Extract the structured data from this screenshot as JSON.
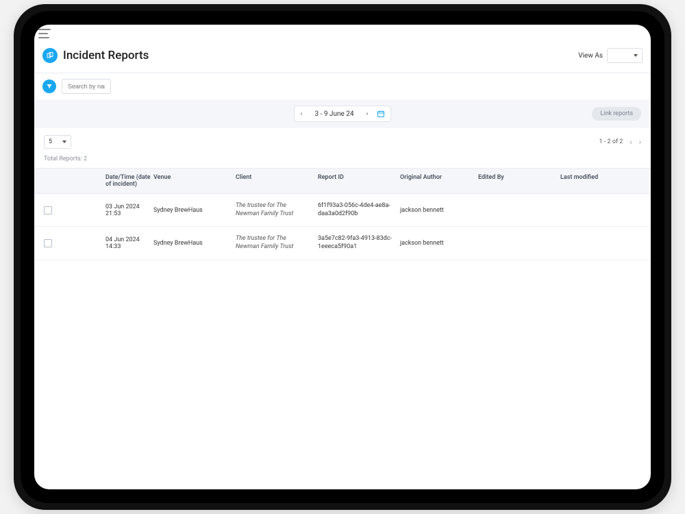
{
  "header": {
    "title": "Incident Reports",
    "view_as_label": "View As"
  },
  "filter": {
    "search_placeholder": "Search by nam"
  },
  "date_range": {
    "label": "3 - 9 June 24",
    "link_reports_label": "Link reports"
  },
  "controls": {
    "page_size": "5",
    "pagination_text": "1 - 2 of 2",
    "total_reports_label": "Total Reports: 2"
  },
  "table": {
    "columns": {
      "datetime": "Date/Time (date of incident)",
      "venue": "Venue",
      "client": "Client",
      "report_id": "Report ID",
      "original_author": "Original Author",
      "edited_by": "Edited By",
      "last_modified": "Last modified"
    },
    "rows": [
      {
        "datetime": "03 Jun 2024 21:53",
        "venue": "Sydney BrewHaus",
        "client": "The trustee for The Newman Family Trust",
        "report_id": "6f1f93a3-056c-4de4-ae8a-daa3a0d2f90b",
        "original_author": "jackson bennett",
        "edited_by": "",
        "last_modified": ""
      },
      {
        "datetime": "04 Jun 2024 14:33",
        "venue": "Sydney BrewHaus",
        "client": "The trustee for The Newman Family Trust",
        "report_id": "3a5e7c82-9fa3-4913-83dc-1eeeca5f90a1",
        "original_author": "jackson bennett",
        "edited_by": "",
        "last_modified": ""
      }
    ]
  }
}
